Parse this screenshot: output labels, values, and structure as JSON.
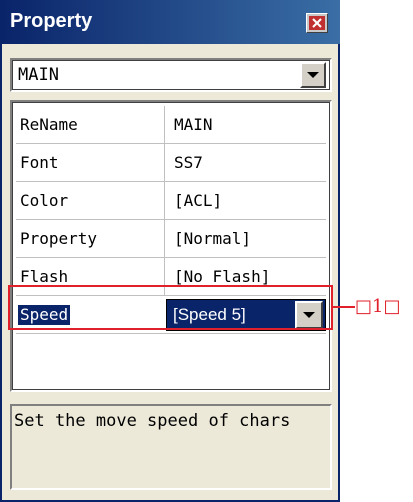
{
  "window": {
    "title": "Property",
    "close_icon": "close-icon",
    "accent": "#0a246a"
  },
  "object_selector": {
    "value": "MAIN"
  },
  "properties": [
    {
      "name": "ReName",
      "value": "MAIN"
    },
    {
      "name": "Font",
      "value": "SS7"
    },
    {
      "name": "Color",
      "value": "[ACL]"
    },
    {
      "name": "Property",
      "value": "[Normal]"
    },
    {
      "name": "Flash",
      "value": "[No Flash]"
    },
    {
      "name": "Speed",
      "value": "[Speed 5]",
      "selected": true
    }
  ],
  "description": "Set the move speed of chars",
  "annotation": {
    "label": "□1□",
    "color": "#e0202a"
  }
}
